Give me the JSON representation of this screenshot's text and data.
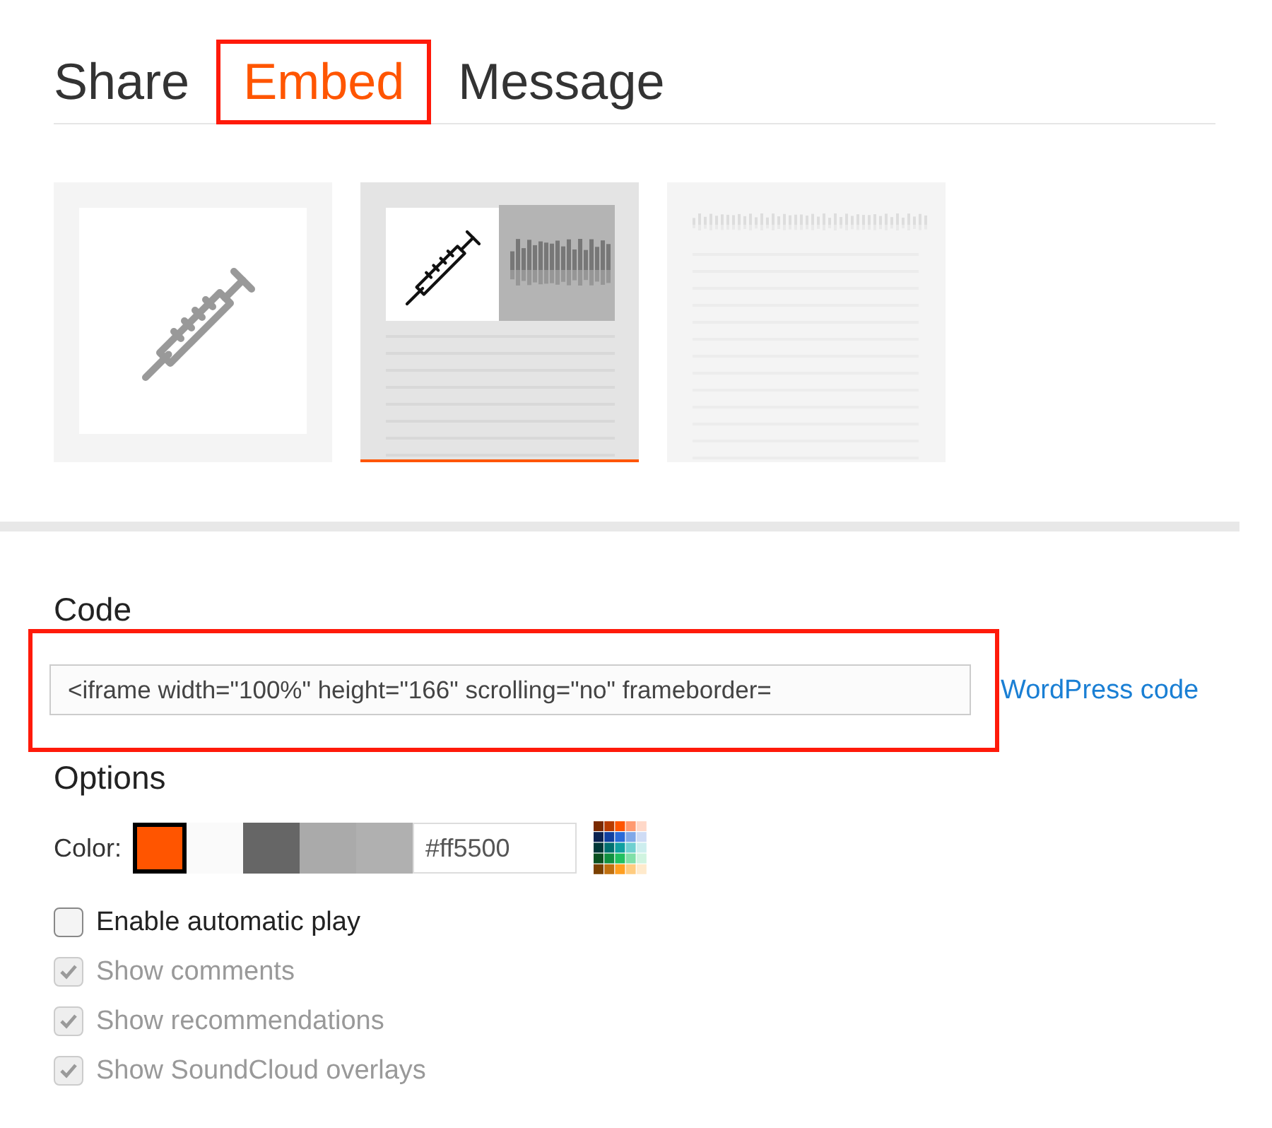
{
  "tabs": [
    {
      "label": "Share",
      "selected": false,
      "highlighted": false
    },
    {
      "label": "Embed",
      "selected": true,
      "highlighted": true
    },
    {
      "label": "Message",
      "selected": false,
      "highlighted": false
    }
  ],
  "player_styles": [
    {
      "kind": "visual",
      "selected": false
    },
    {
      "kind": "classic",
      "selected": true
    },
    {
      "kind": "mini",
      "selected": false
    }
  ],
  "code": {
    "label": "Code",
    "value": "<iframe width=\"100%\" height=\"166\" scrolling=\"no\" frameborder=",
    "highlighted": true,
    "link": "WordPress code"
  },
  "options": {
    "title": "Options",
    "color": {
      "label": "Color:",
      "swatches": [
        {
          "color": "#ff5500",
          "selected": true
        },
        {
          "color": "#fafafa",
          "selected": false
        },
        {
          "color": "#666666",
          "selected": false
        },
        {
          "color": "#aaaaaa",
          "selected": false
        },
        {
          "color": "#b0b0b0",
          "selected": false
        }
      ],
      "value": "#ff5500"
    },
    "checkboxes": [
      {
        "label": "Enable automatic play",
        "checked": false,
        "disabled": false
      },
      {
        "label": "Show comments",
        "checked": true,
        "disabled": true
      },
      {
        "label": "Show recommendations",
        "checked": true,
        "disabled": true
      },
      {
        "label": "Show SoundCloud overlays",
        "checked": true,
        "disabled": true
      }
    ]
  }
}
